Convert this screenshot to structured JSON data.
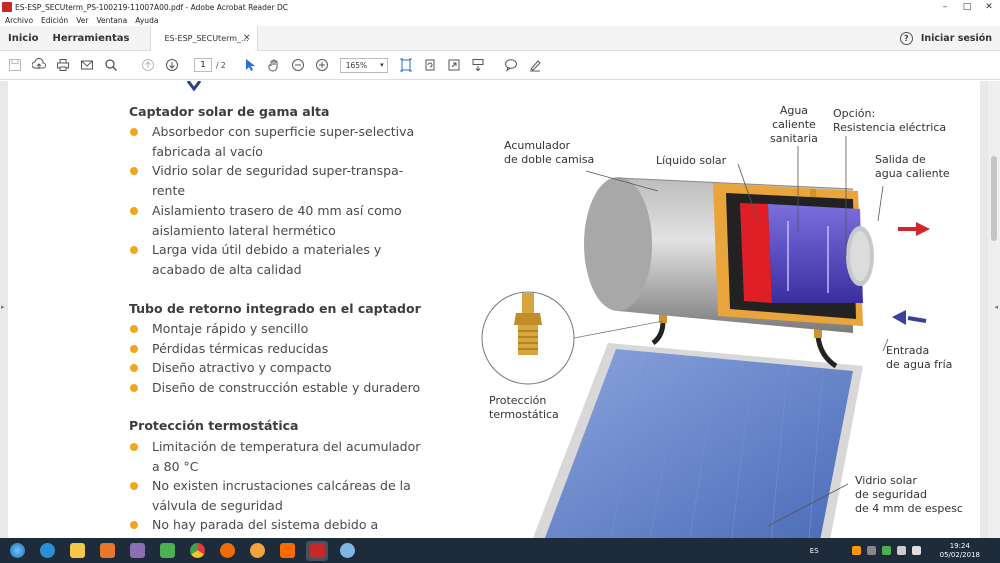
{
  "window": {
    "title": "ES-ESP_SECUterm_PS-100219-11007A00.pdf - Adobe Acrobat Reader DC",
    "minimize": "–",
    "maximize": "□",
    "close": "✕"
  },
  "menu": [
    "Archivo",
    "Edición",
    "Ver",
    "Ventana",
    "Ayuda"
  ],
  "tabs": {
    "home": "Inicio",
    "tools": "Herramientas",
    "document": "ES-ESP_SECUterm_...",
    "close": "×",
    "help": "?",
    "signin": "Iniciar sesión"
  },
  "toolbar": {
    "page_current": "1",
    "page_total": "/ 2",
    "zoom": "165%"
  },
  "document": {
    "sections": [
      {
        "title": "Captador solar de gama alta",
        "bullets": [
          [
            "Absorbedor con superficie super-selectiva",
            "fabricada al vacío"
          ],
          [
            "Vidrio solar de seguridad super-transpa-",
            "rente"
          ],
          [
            "Aislamiento trasero de 40 mm así como",
            "aislamiento lateral hermético"
          ],
          [
            "Larga vida útil debido a materiales y",
            "acabado de alta calidad"
          ]
        ]
      },
      {
        "title": "Tubo de retorno integrado en el captador",
        "bullets": [
          [
            "Montaje rápido y sencillo"
          ],
          [
            "Pérdidas térmicas reducidas"
          ],
          [
            "Diseño atractivo y compacto"
          ],
          [
            "Diseño de construcción estable y duradero"
          ]
        ]
      },
      {
        "title": "Protección termostática",
        "bullets": [
          [
            "Limitación de temperatura del acumulador",
            "a 80 °C"
          ],
          [
            "No existen incrustaciones calcáreas de la",
            "válvula de seguridad"
          ],
          [
            "No hay parada del sistema debido a"
          ]
        ]
      }
    ],
    "diagram_labels": {
      "acumulador": [
        "Acumulador",
        "de doble camisa"
      ],
      "liquido": [
        "Líquido solar"
      ],
      "agua": [
        "Agua",
        "caliente",
        "sanitaria"
      ],
      "opcion": [
        "Opción:",
        "Resistencia eléctrica"
      ],
      "salida": [
        "Salida de",
        "agua caliente"
      ],
      "entrada": [
        "Entrada",
        "de agua fría"
      ],
      "proteccion": [
        "Protección",
        "termostática"
      ],
      "vidrio": [
        "Vidrio solar",
        "de seguridad",
        "de 4 mm de espesc"
      ]
    }
  },
  "taskbar": {
    "lang": "ES",
    "time": "19:24",
    "date": "05/02/2018"
  },
  "colors": {
    "bullet": "#f2a71b",
    "arrow_hot": "#d0252b",
    "arrow_cold": "#3b3f9e",
    "insulation": "#e9a53c",
    "tank_gray": "#9a9a9a",
    "panel_blue": "#5d7fc6"
  }
}
